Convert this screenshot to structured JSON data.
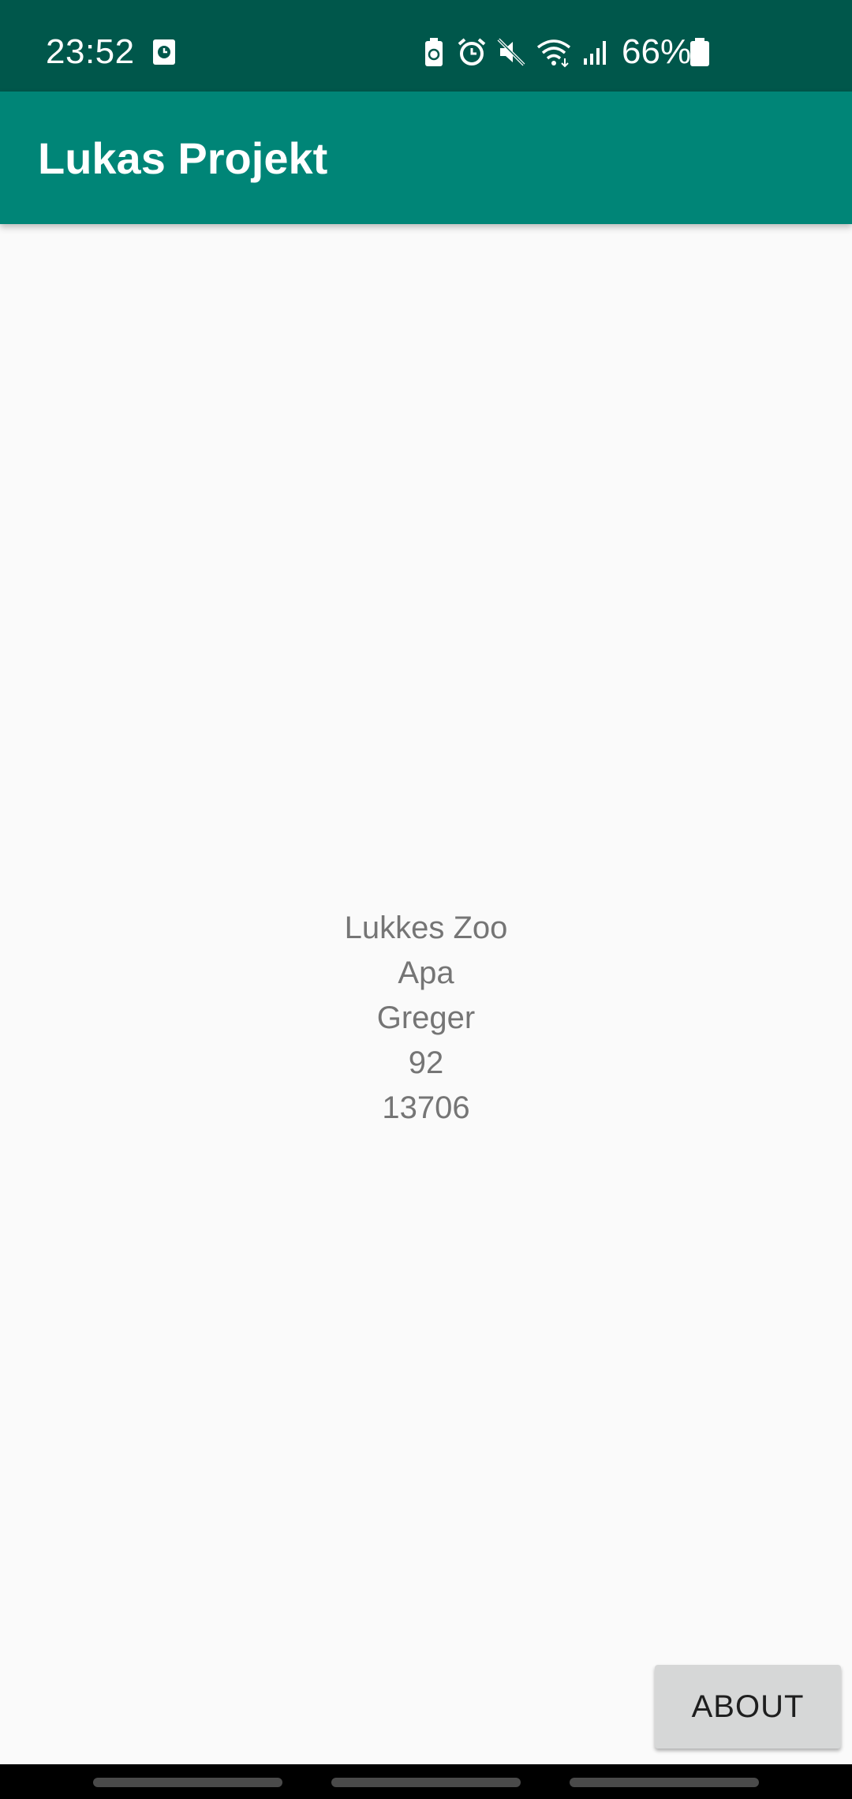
{
  "status_bar": {
    "time": "23:52",
    "battery_percent": "66%",
    "icons": [
      "clock-notification-icon",
      "battery-saver-icon",
      "alarm-icon",
      "mute-icon",
      "wifi-icon",
      "signal-icon",
      "battery-icon"
    ],
    "background_color": "#00574b"
  },
  "app_bar": {
    "title": "Lukas Projekt",
    "background_color": "#008577"
  },
  "main": {
    "lines": [
      "Lukkes Zoo",
      "Apa",
      "Greger",
      "92",
      "13706"
    ],
    "text_color": "#757575"
  },
  "about_button": {
    "label": "ABOUT"
  },
  "nav_bar": {
    "items": [
      "recent-apps-pill",
      "home-pill",
      "back-pill"
    ]
  }
}
